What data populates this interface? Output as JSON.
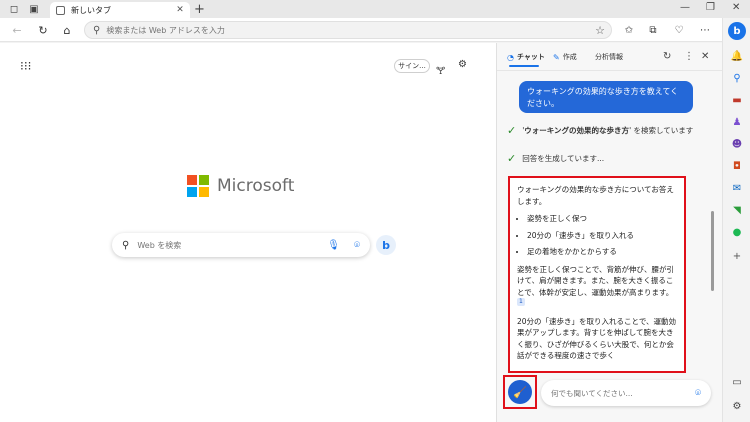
{
  "browser": {
    "tab_title": "新しいタブ",
    "address_placeholder": "検索または Web アドレスを入力"
  },
  "newtab": {
    "signin_label": "サイン...",
    "logo_text": "Microsoft",
    "search_placeholder": "Web を検索",
    "bing_label": "b"
  },
  "copilot": {
    "tabs": [
      {
        "label": "チャット"
      },
      {
        "label": "作成"
      },
      {
        "label": "分析情報"
      }
    ],
    "user_message": "ウォーキングの効果的な歩き方を教えてください。",
    "status": [
      {
        "keyword": "ウォーキングの効果的な歩き方",
        "text": "を検索しています"
      },
      {
        "text": "回答を生成しています..."
      }
    ],
    "answer_intro": "ウォーキングの効果的な歩き方についてお答えします。",
    "answer_points": [
      "姿勢を正しく保つ",
      "20分の「速歩き」を取り入れる",
      "足の着地をかかとからする"
    ],
    "answer_para1": "姿勢を正しく保つことで、背筋が伸び、腰が引けて、肩が開きます。また、腕を大きく振ることで、体幹が安定し、運動効果が高まります。",
    "citation": "1",
    "answer_para2": "20分の「速歩き」を取り入れることで、運動効果がアップします。背すじを伸ばして腕を大きく振り、ひざが伸びるくらい大股で、何とか会話ができる程度の速さで歩く",
    "prompt_placeholder": "何でも聞いてください..."
  },
  "colors": {
    "accent": "#1a73e8",
    "highlight": "#e0101a",
    "ms_red": "#f25022",
    "ms_green": "#7fba00",
    "ms_blue": "#00a4ef",
    "ms_yellow": "#ffb900"
  }
}
